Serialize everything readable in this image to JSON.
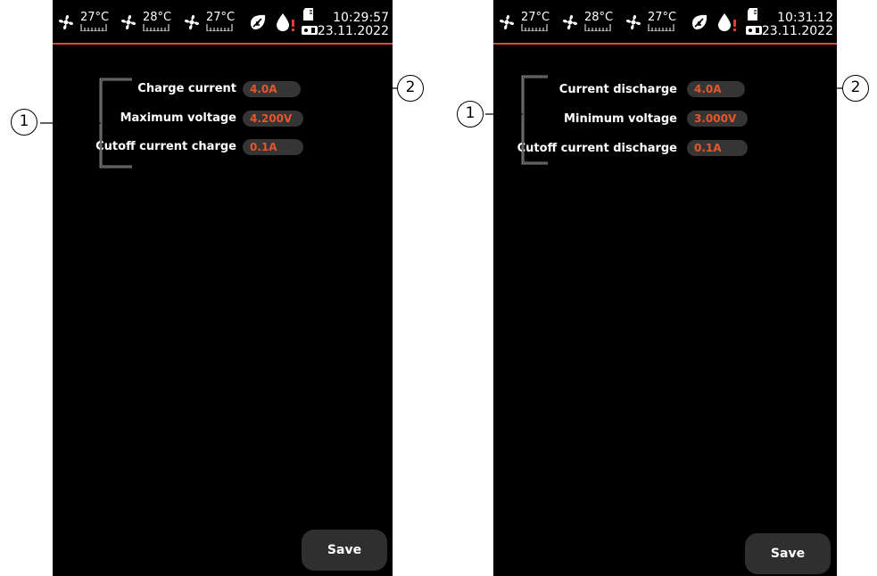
{
  "left_screen": {
    "status": {
      "temps": [
        "27°C",
        "28°C",
        "27°C"
      ],
      "time": "10:29:57",
      "date": "23.11.2022"
    },
    "rows": [
      {
        "label": "Charge current",
        "value": "4.0A"
      },
      {
        "label": "Maximum voltage",
        "value": "4.200V"
      },
      {
        "label": "Cutoff current charge",
        "value": "0.1A"
      }
    ],
    "save_label": "Save"
  },
  "right_screen": {
    "status": {
      "temps": [
        "27°C",
        "28°C",
        "27°C"
      ],
      "time": "10:31:12",
      "date": "23.11.2022"
    },
    "rows": [
      {
        "label": "Current discharge",
        "value": "4.0A"
      },
      {
        "label": "Minimum voltage",
        "value": "3.000V"
      },
      {
        "label": "Cutoff current discharge",
        "value": "0.1A"
      }
    ],
    "save_label": "Save"
  },
  "callouts": {
    "left_group": "1",
    "left_field": "2",
    "right_group": "1",
    "right_field": "2"
  },
  "colors": {
    "accent": "#e04a2c",
    "value_text": "#e2572e",
    "field_bg": "#353535",
    "alert": "#e53935"
  },
  "icons": [
    "fan-icon",
    "temperature-scale-icon",
    "battery-leaf-icon",
    "drop-alert-icon",
    "sd-card-icon",
    "usb-icon"
  ]
}
